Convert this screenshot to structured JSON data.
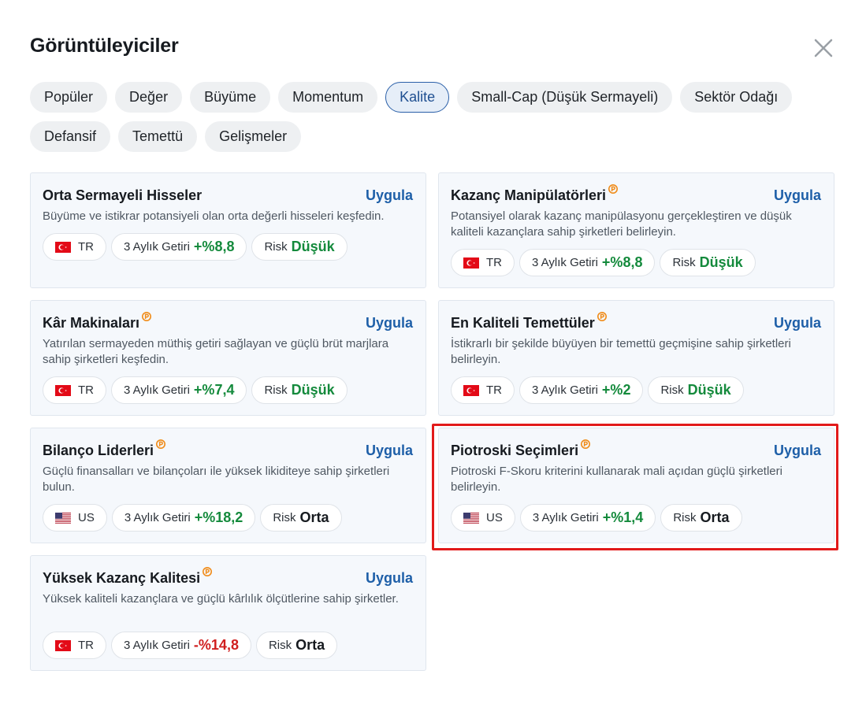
{
  "title": "Görüntüleyiciler",
  "tabs": [
    {
      "label": "Popüler",
      "active": false
    },
    {
      "label": "Değer",
      "active": false
    },
    {
      "label": "Büyüme",
      "active": false
    },
    {
      "label": "Momentum",
      "active": false
    },
    {
      "label": "Kalite",
      "active": true
    },
    {
      "label": "Small-Cap (Düşük Sermayeli)",
      "active": false
    },
    {
      "label": "Sektör Odağı",
      "active": false
    },
    {
      "label": "Defansif",
      "active": false
    },
    {
      "label": "Temettü",
      "active": false
    },
    {
      "label": "Gelişmeler",
      "active": false
    }
  ],
  "apply_label": "Uygula",
  "return_label": "3 Aylık Getiri",
  "risk_label": "Risk",
  "cards": [
    {
      "title": "Orta Sermayeli Hisseler",
      "premium": false,
      "desc": "Büyüme ve istikrar potansiyeli olan orta değerli hisseleri keşfedin.",
      "country": "TR",
      "return": "+%8,8",
      "return_sign": "pos",
      "risk": "Düşük",
      "risk_level": "low"
    },
    {
      "title": "Kazanç Manipülatörleri",
      "premium": true,
      "desc": "Potansiyel olarak kazanç manipülasyonu gerçekleştiren ve düşük kaliteli kazançlara sahip şirketleri belirleyin.",
      "country": "TR",
      "return": "+%8,8",
      "return_sign": "pos",
      "risk": "Düşük",
      "risk_level": "low"
    },
    {
      "title": "Kâr Makinaları",
      "premium": true,
      "desc": "Yatırılan sermayeden müthiş getiri sağlayan ve güçlü brüt marjlara sahip şirketleri keşfedin.",
      "country": "TR",
      "return": "+%7,4",
      "return_sign": "pos",
      "risk": "Düşük",
      "risk_level": "low"
    },
    {
      "title": "En Kaliteli Temettüler",
      "premium": true,
      "desc": "İstikrarlı bir şekilde büyüyen bir temettü geçmişine sahip şirketleri belirleyin.",
      "country": "TR",
      "return": "+%2",
      "return_sign": "pos",
      "risk": "Düşük",
      "risk_level": "low"
    },
    {
      "title": "Bilanço Liderleri",
      "premium": true,
      "desc": "Güçlü finansalları ve bilançoları ile yüksek likiditeye sahip şirketleri bulun.",
      "country": "US",
      "return": "+%18,2",
      "return_sign": "pos",
      "risk": "Orta",
      "risk_level": "mid"
    },
    {
      "title": "Piotroski Seçimleri",
      "premium": true,
      "desc": "Piotroski F-Skoru kriterini kullanarak mali açıdan güçlü şirketleri belirleyin.",
      "country": "US",
      "return": "+%1,4",
      "return_sign": "pos",
      "risk": "Orta",
      "risk_level": "mid",
      "highlighted": true
    },
    {
      "title": "Yüksek Kazanç Kalitesi",
      "premium": true,
      "desc": "Yüksek kaliteli kazançlara ve güçlü kârlılık ölçütlerine sahip şirketler.",
      "country": "TR",
      "return": "-%14,8",
      "return_sign": "neg",
      "risk": "Orta",
      "risk_level": "mid"
    }
  ],
  "colors": {
    "accent": "#1e5fa8",
    "positive": "#148a3c",
    "negative": "#d01f1f",
    "highlight": "#e21a1a"
  }
}
